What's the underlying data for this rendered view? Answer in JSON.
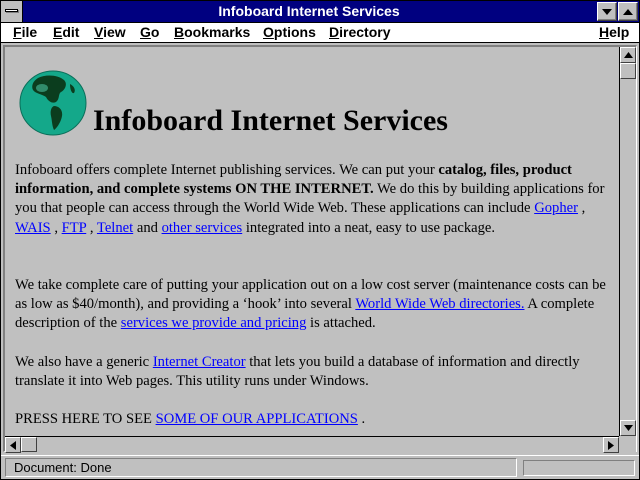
{
  "window": {
    "title": "Infoboard Internet Services"
  },
  "menu": [
    {
      "label": "File",
      "acc": "F",
      "rest": "ile"
    },
    {
      "label": "Edit",
      "acc": "E",
      "rest": "dit"
    },
    {
      "label": "View",
      "acc": "V",
      "rest": "iew"
    },
    {
      "label": "Go",
      "acc": "G",
      "rest": "o"
    },
    {
      "label": "Bookmarks",
      "acc": "B",
      "rest": "ookmarks"
    },
    {
      "label": "Options",
      "acc": "O",
      "rest": "ptions"
    },
    {
      "label": "Directory",
      "acc": "D",
      "rest": "irectory"
    },
    {
      "label": "Help",
      "acc": "H",
      "rest": "elp"
    }
  ],
  "page": {
    "heading": "Infoboard Internet Services",
    "p1": {
      "t1": "Infoboard offers complete Internet publishing services. We can put your ",
      "bold": "catalog, files, product information, and complete systems ON THE INTERNET.",
      "t2": " We do this by building applications for you that people can access through the World Wide Web. These applications can include ",
      "link_gopher": "Gopher",
      "sep1": " , ",
      "link_wais": "WAIS",
      "sep2": " , ",
      "link_ftp": "FTP",
      "sep3": " , ",
      "link_telnet": "Telnet",
      "t3": " and ",
      "link_other": "other services",
      "t4": " integrated into a neat, easy to use package."
    },
    "p2": {
      "t1": "We take complete care of putting your application out on a low cost server (maintenance costs can be as low as $40/month), and providing a ‘hook’ into several ",
      "link_www": "World Wide Web directories.",
      "t2": " A complete description of the ",
      "link_services": "services we provide and pricing",
      "t3": " is attached."
    },
    "p3": {
      "t1": "We also have a generic ",
      "link_creator": "Internet Creator",
      "t2": " that lets you build a database of information and directly translate it into Web pages. This utility runs under Windows."
    },
    "p4": {
      "t1": "PRESS HERE TO SEE ",
      "link_apps": "SOME OF OUR APPLICATIONS",
      "t2": " ."
    }
  },
  "status": {
    "text": "Document: Done",
    "progress": 0
  },
  "icons": {
    "globe": "globe-icon",
    "system_menu": "system-menu-icon",
    "minimize": "minimize-arrow-icon",
    "maximize": "maximize-arrow-icon"
  },
  "colors": {
    "title_bar": "#000080",
    "link": "#0000ff",
    "background": "#c0c0c0"
  }
}
